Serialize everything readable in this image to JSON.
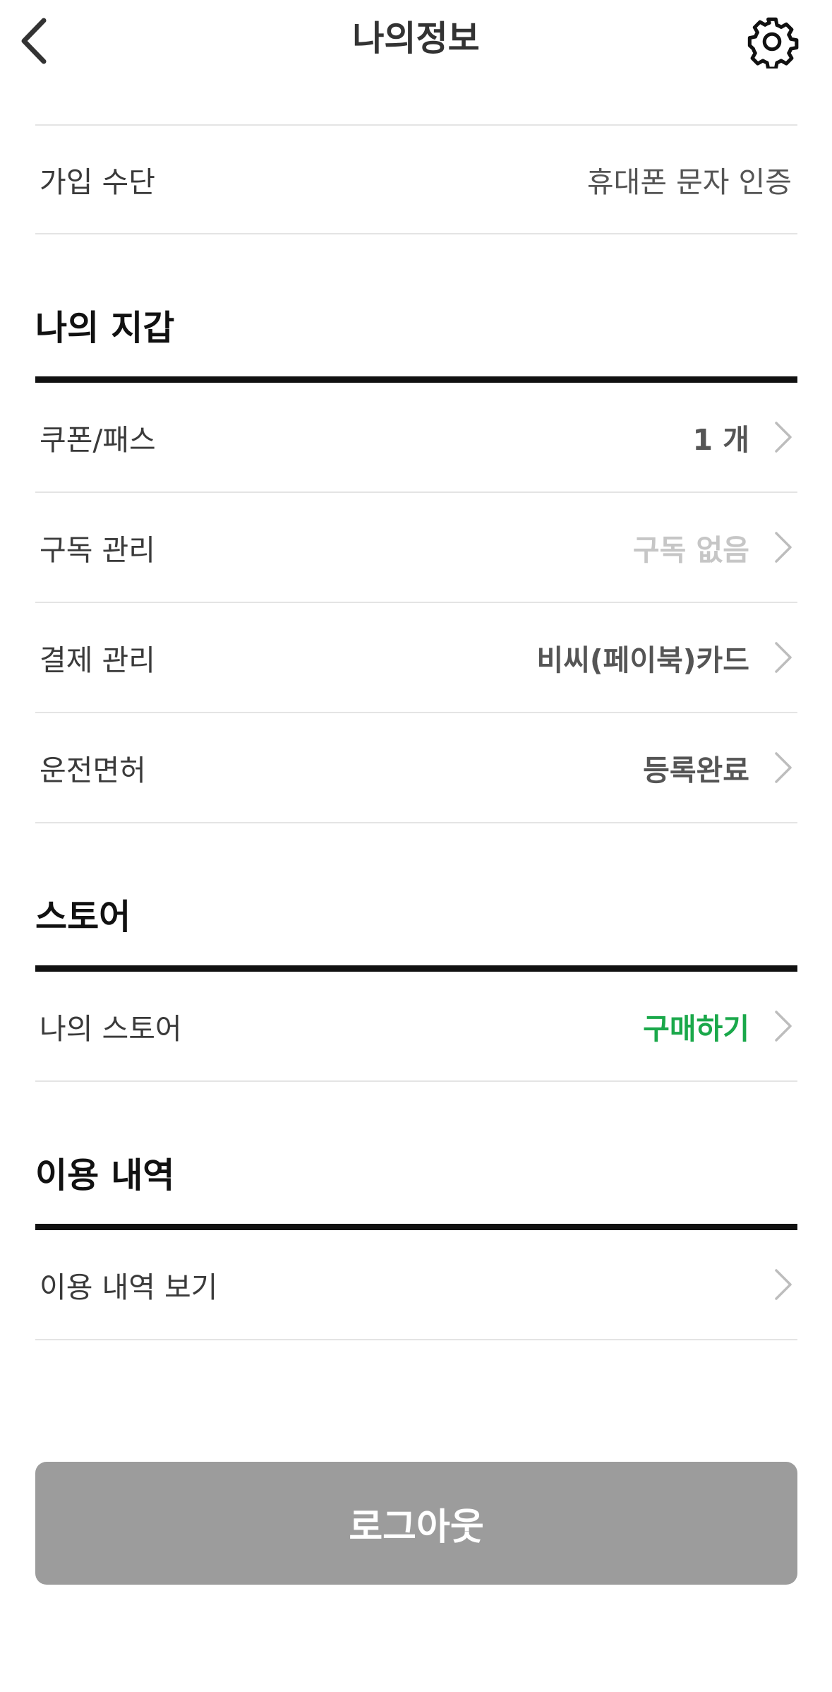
{
  "header": {
    "title": "나의정보"
  },
  "signup": {
    "label": "가입 수단",
    "value": "휴대폰 문자 인증"
  },
  "wallet": {
    "title": "나의 지갑",
    "items": [
      {
        "label": "쿠폰/패스",
        "value": "1 개"
      },
      {
        "label": "구독 관리",
        "value": "구독 없음"
      },
      {
        "label": "결제 관리",
        "value": "비씨(페이북)카드"
      },
      {
        "label": "운전면허",
        "value": "등록완료"
      }
    ]
  },
  "store": {
    "title": "스토어",
    "items": [
      {
        "label": "나의 스토어",
        "value": "구매하기"
      }
    ]
  },
  "history": {
    "title": "이용 내역",
    "items": [
      {
        "label": "이용 내역 보기"
      }
    ]
  },
  "logout": {
    "label": "로그아웃"
  },
  "colors": {
    "accent_green": "#1aa84a",
    "logout_bg": "#9c9c9c",
    "muted": "#c6c6c6"
  }
}
